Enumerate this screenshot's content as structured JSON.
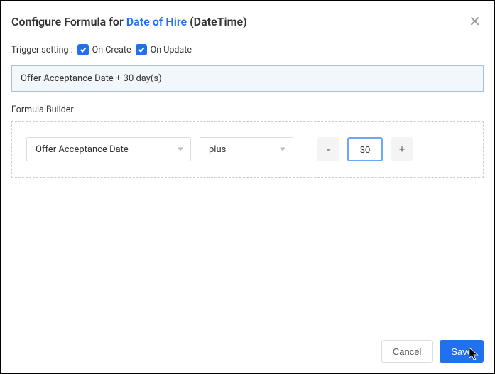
{
  "header": {
    "title_prefix": "Configure Formula for ",
    "title_link": "Date of Hire",
    "title_suffix": " (DateTime)"
  },
  "trigger": {
    "label": "Trigger setting :",
    "on_create": "On Create",
    "on_update": "On Update"
  },
  "formula_preview": "Offer Acceptance Date + 30 day(s)",
  "builder": {
    "label": "Formula Builder",
    "field": "Offer Acceptance Date",
    "operator": "plus",
    "minus": "-",
    "value": "30",
    "plus": "+"
  },
  "footer": {
    "cancel": "Cancel",
    "save": "Save"
  }
}
